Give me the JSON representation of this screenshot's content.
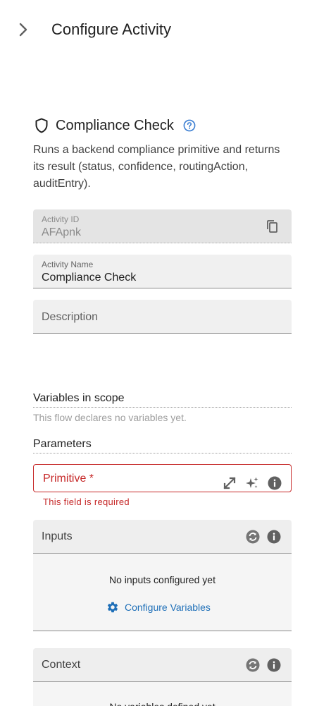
{
  "header": {
    "title": "Configure Activity"
  },
  "activity": {
    "title": "Compliance Check",
    "description": "Runs a backend compliance primitive and returns its result (status, confidence, routingAction, auditEntry)."
  },
  "fields": {
    "activity_id": {
      "label": "Activity ID",
      "value": "AFApnk"
    },
    "activity_name": {
      "label": "Activity Name",
      "value": "Compliance Check"
    },
    "description": {
      "placeholder": "Description"
    }
  },
  "variables": {
    "heading": "Variables in scope",
    "empty_note": "This flow declares no variables yet."
  },
  "parameters": {
    "heading": "Parameters",
    "primitive": {
      "label": "Primitive *",
      "error": "This field is required"
    }
  },
  "inputs": {
    "title": "Inputs",
    "empty": "No inputs configured yet",
    "configure_label": "Configure Variables"
  },
  "context": {
    "title": "Context",
    "empty": "No variables defined yet"
  },
  "colors": {
    "error": "#c62828",
    "link": "#1e6fb8",
    "help": "#3b7ed2",
    "icon_gray": "#757575"
  }
}
